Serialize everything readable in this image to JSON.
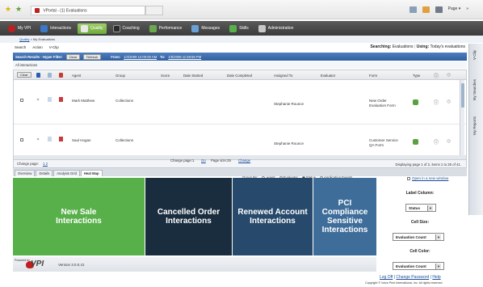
{
  "browser": {
    "tab_title": "VPortal - (1) Evaluations",
    "page_label": "Page"
  },
  "nav": {
    "items": [
      {
        "label": "My VPI"
      },
      {
        "label": "Interactions"
      },
      {
        "label": "Quality"
      },
      {
        "label": "Coaching"
      },
      {
        "label": "Performance"
      },
      {
        "label": "Messages"
      },
      {
        "label": "Skills"
      },
      {
        "label": "Administration"
      }
    ],
    "active_index": 2
  },
  "breadcrumb": {
    "link": "Quality",
    "rest": " > My Evaluations"
  },
  "menu": {
    "items": [
      "Search",
      "Action",
      "V-Clip"
    ],
    "searching_label": "Searching:",
    "searching_value": "Evaluations",
    "using_label": "Using:",
    "using_value": "Today's evaluations"
  },
  "results_bar": {
    "title": "Search Results - Hyper Filter:",
    "clear": "Clear",
    "refresh": "Refresh",
    "from_label": "From:",
    "from_value": "1/4/2009 12:00:00 AM",
    "to_label": "To:",
    "to_value": "1/5/2009 11:59:59 PM",
    "sub": "All interactions"
  },
  "vertical_tabs": [
    "V-Clip",
    "My Searches",
    "My Reports"
  ],
  "table": {
    "clear": "Clear",
    "headers": [
      "Agent",
      "Group",
      "Score",
      "Date Started",
      "Date Completed",
      "Assigned To",
      "Evaluator",
      "Form",
      "Type"
    ],
    "rows": [
      {
        "agent": "Mark Matthew",
        "group": "Collections",
        "assigned_to": "Stephanie Rounce",
        "form_line1": "New Order",
        "form_line2": "Evaluation Form"
      },
      {
        "agent": "Saul Hogan",
        "group": "Collections",
        "assigned_to": "Stephanie Rounce",
        "form_line1": "Customer Service",
        "form_line2": "QA Form"
      }
    ],
    "change_page_label": "Change page:",
    "pages": "1 2",
    "center_footer": "Change page:1",
    "go": "Go",
    "page_size_label": "Page size:25",
    "change": "Change",
    "displaying": "Displaying page 1 of 2, items 1 to 25 of 41."
  },
  "tabs": {
    "items": [
      "Overview",
      "Details",
      "Analysis Grid",
      "Heat Map"
    ],
    "active_index": 3
  },
  "groupby": {
    "label": "Group By:",
    "options": [
      "Agent",
      "Evaluator",
      "Status",
      "Application Events"
    ],
    "selected_index": 2
  },
  "open_new_window": "Open in a new window",
  "heatmap": {
    "cells": [
      {
        "label": "New Sale Interactions",
        "color": "#58b04a"
      },
      {
        "label": "Cancelled Order Interactions",
        "color": "#1a2d3f"
      },
      {
        "label": "Renewed Account Interactions",
        "color": "#27496b"
      },
      {
        "label": "PCI Compliance Sensitive Interactions",
        "color": "#3e6d9a"
      }
    ]
  },
  "side_panel": {
    "label_column_label": "Label Column:",
    "label_column_value": "Status",
    "cell_size_label": "Cell Size:",
    "cell_size_value": "Evaluation Count",
    "cell_color_label": "Cell Color:",
    "cell_color_value": "Evaluation Count"
  },
  "footer": {
    "powered_by": "Powered by",
    "logo": "VPI",
    "version": "Version 3.0.0.41",
    "logoff": "Log Off",
    "change_password": "Change Password",
    "help": "Help",
    "copyright": "Copyright © Voice Print International, Inc. All rights reserved."
  },
  "colors": {
    "nav_active": "#6fa93a",
    "results_bar": "#2f5f9e"
  }
}
